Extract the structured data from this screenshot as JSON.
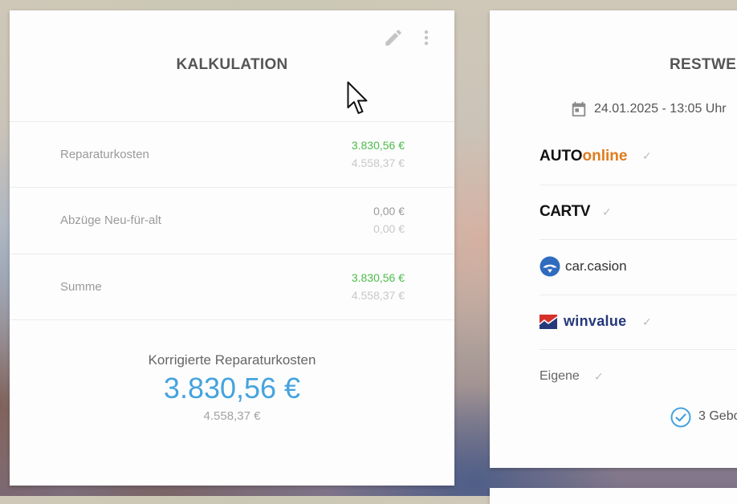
{
  "calculation_card": {
    "title": "KALKULATION",
    "rows": [
      {
        "label": "Reparaturkosten",
        "value": "3.830,56 €",
        "value_secondary": "4.558,37 €",
        "value_color": "#4cbb4c"
      },
      {
        "label": "Abzüge Neu-für-alt",
        "value": "0,00 €",
        "value_secondary": "0,00 €",
        "value_color": "#9a9a9a"
      },
      {
        "label": "Summe",
        "value": "3.830,56 €",
        "value_secondary": "4.558,37 €",
        "value_color": "#4cbb4c"
      }
    ],
    "corrected": {
      "label": "Korrigierte Reparaturkosten",
      "value": "3.830,56 €",
      "value_secondary": "4.558,37 €"
    },
    "icons": [
      "pencil-icon",
      "more-vertical-icon"
    ]
  },
  "residual_card": {
    "title": "RESTWE",
    "date": "24.01.2025 - 13:05 Uhr",
    "providers": [
      {
        "name_part1": "AUTO",
        "name_part2": "online",
        "checked": true
      },
      {
        "name": "CARTV",
        "checked": true
      },
      {
        "name": "car.casion",
        "checked": false
      },
      {
        "name": "winvalue",
        "checked": true
      },
      {
        "name": "Eigene",
        "checked": true
      }
    ],
    "offers_text": "3 Gebo",
    "check_glyph": "✓"
  },
  "colors": {
    "accent_blue": "#45a3df",
    "positive_green": "#4cbb4c",
    "autoonline_orange": "#e07b1c"
  }
}
